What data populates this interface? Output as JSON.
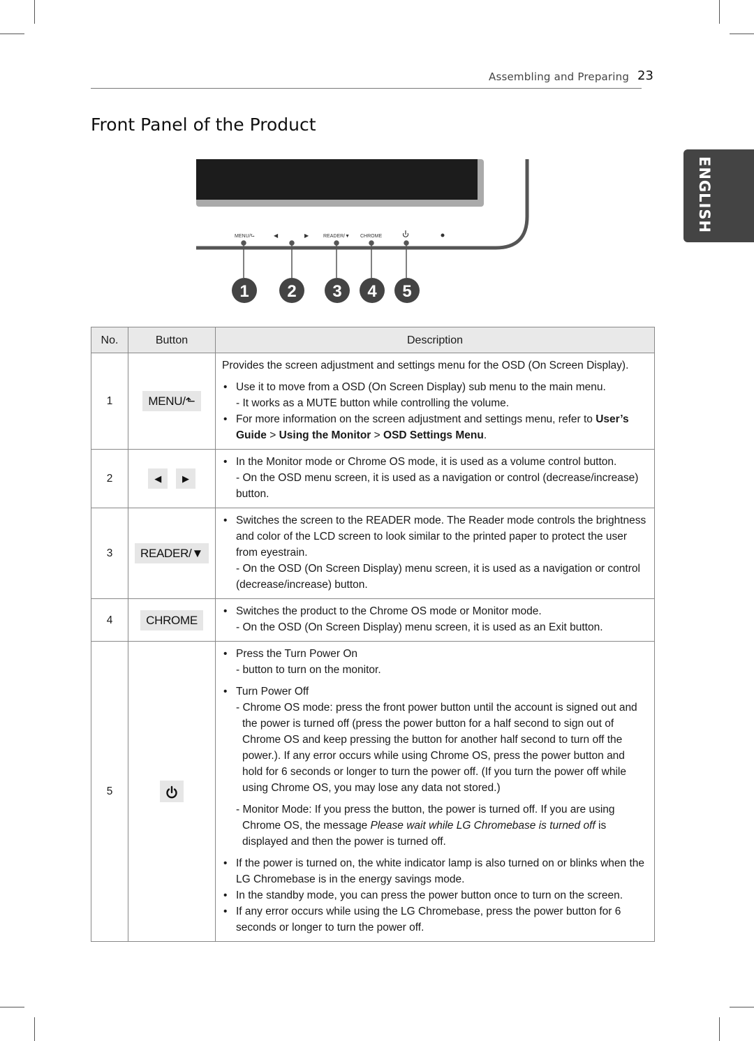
{
  "header": {
    "section": "Assembling and Preparing",
    "page_number": "23",
    "language_tab": "ENGLISH"
  },
  "title": "Front Panel of the Product",
  "diagram": {
    "panel_labels": [
      "MENU/⬑",
      "◀",
      "▶",
      "READER/▼",
      "CHROME",
      "power-icon",
      "indicator-lamp"
    ],
    "callouts": [
      "1",
      "2",
      "3",
      "4",
      "5"
    ]
  },
  "table": {
    "headers": {
      "no": "No.",
      "button": "Button",
      "description": "Description"
    },
    "rows": [
      {
        "no": "1",
        "button": "MENU/⬑",
        "intro": "Provides the screen adjustment and settings menu for the OSD (On Screen Display).",
        "bullet1": "Use it to move from a OSD (On Screen Display) sub menu to the main menu.",
        "bullet1_sub": "- It works as a MUTE button while controlling the volume.",
        "bullet2_pre": "For more information on the screen adjustment and settings menu, refer to ",
        "bullet2_ref1": "User’s Guide",
        "sep1": " > ",
        "bullet2_ref2": "Using the Monitor",
        "sep2": " > ",
        "bullet2_ref3": "OSD Settings Menu",
        "bullet2_end": "."
      },
      {
        "no": "2",
        "button_left": "◀",
        "button_right": "▶",
        "bullet1": "In the Monitor mode or Chrome OS mode, it is used as a volume control button.",
        "bullet1_sub": "- On the OSD menu screen, it is used as a navigation or control (decrease/increase) button."
      },
      {
        "no": "3",
        "button": "READER/▼",
        "bullet1": "Switches the screen to the READER mode. The Reader mode controls the brightness and color of the LCD screen to look similar to the printed paper to protect the user from eyestrain.",
        "bullet1_sub": "- On the OSD (On Screen Display) menu screen, it is used as a navigation or control (decrease/increase) button."
      },
      {
        "no": "4",
        "button": "CHROME",
        "bullet1": "Switches the product to the Chrome OS mode or Monitor mode.",
        "bullet1_sub": "- On the OSD (On Screen Display) menu screen, it is used as an Exit button."
      },
      {
        "no": "5",
        "button_icon": "power-icon",
        "bullet1": "Press the Turn Power On",
        "bullet1_sub": "- button to turn on the monitor.",
        "bullet2": "Turn Power Off",
        "bullet2_sub1": "- Chrome OS mode: press the front power button until the account is signed out and the power is turned off (press the power button for a half second to sign out of Chrome OS and keep pressing the button for another half second to turn off the power.).  If any error occurs while using Chrome OS, press the power button and hold for 6 seconds or longer to turn the power off. (If you turn the power off while using Chrome OS, you may lose any data not stored.)",
        "bullet2_sub2_pre": "- Monitor Mode: If you press the button, the power is turned off. If you are using Chrome OS, the message ",
        "bullet2_sub2_italic": "Please wait while LG Chromebase is turned off",
        "bullet2_sub2_post": " is displayed and then the power is turned off.",
        "bullet3": "If the power is turned on, the white indicator lamp is also turned on or blinks when the LG Chromebase is in the energy savings mode.",
        "bullet4": "In the standby mode, you can press the power button once to turn on the screen.",
        "bullet5": "If any error occurs while using the LG Chromebase, press the power button for 6 seconds or longer to turn the power off."
      }
    ]
  }
}
